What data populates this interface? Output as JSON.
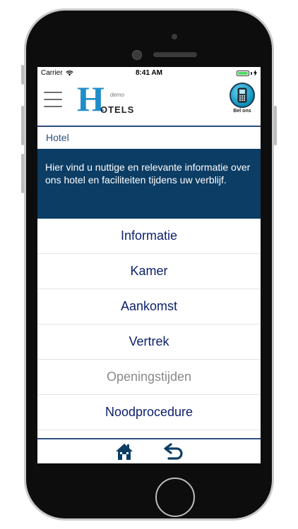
{
  "status_bar": {
    "carrier": "Carrier",
    "time": "8:41 AM",
    "battery_level": 1.0,
    "battery_color": "#4cd964"
  },
  "header": {
    "menu_icon": "hamburger-icon",
    "logo": {
      "letter": "H",
      "demo": "demo",
      "word": "OTELS",
      "color": "#1f8dc9"
    },
    "call_button": {
      "label": "Bel ons",
      "icon": "phone-icon"
    }
  },
  "breadcrumb": "Hotel",
  "info_text": "Hier vind u nuttige en relevante informatie over ons hotel en faciliteiten tijdens uw verblijf.",
  "menu_items": [
    {
      "label": "Informatie",
      "enabled": true
    },
    {
      "label": "Kamer",
      "enabled": true
    },
    {
      "label": "Aankomst",
      "enabled": true
    },
    {
      "label": "Vertrek",
      "enabled": true
    },
    {
      "label": "Openingstijden",
      "enabled": false
    },
    {
      "label": "Noodprocedure",
      "enabled": true
    }
  ],
  "tab_bar": {
    "icons": [
      "home-icon",
      "back-arrow-icon"
    ],
    "color": "#0c3d64"
  },
  "colors": {
    "primary": "#0c3d64",
    "menu_text": "#0c1f6b",
    "accent": "#2d4f7c"
  }
}
